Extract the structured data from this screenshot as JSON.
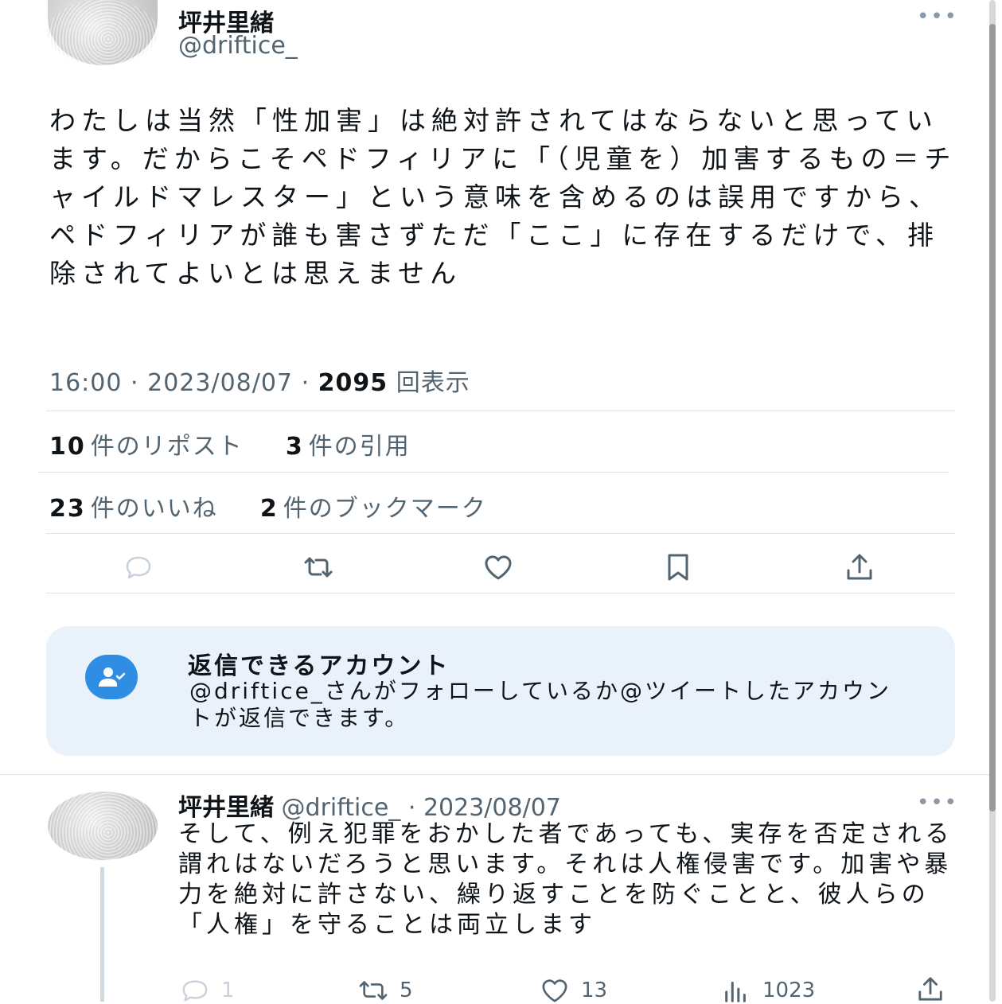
{
  "tweet": {
    "author_name": "坪井里緒",
    "author_handle": "@driftice_",
    "more_label": "•••",
    "text": "わたしは当然「性加害」は絶対許されてはならないと思っています。だからこそペドフィリアに「（児童を）加害するもの＝チャイルドマレスター」という意味を含めるのは誤用ですから、ペドフィリアが誰も害さずただ「ここ」に存在するだけで、排除されてよいとは思えません",
    "time": "16:00",
    "date": "2023/08/07",
    "sep": "·",
    "views_count": "2095",
    "views_label": "回表示"
  },
  "stats": {
    "reposts_count": "10",
    "reposts_label": "件のリポスト",
    "quotes_count": "3",
    "quotes_label": "件の引用",
    "likes_count": "23",
    "likes_label": "件のいいね",
    "bookmarks_count": "2",
    "bookmarks_label": "件のブックマーク"
  },
  "reply_restriction": {
    "title": "返信できるアカウント",
    "description": "@driftice_さんがフォローしているか@ツイートしたアカウントが返信できます。"
  },
  "reply": {
    "author_name": "坪井里緒",
    "author_handle": "@driftice_",
    "date": "· 2023/08/07",
    "more_label": "•••",
    "text": "そして、例え犯罪をおかした者であっても、実存を否定される謂れはないだろうと思います。それは人権侵害です。加害や暴力を絶対に許さない、繰り返すことを防ぐことと、彼人らの「人権」を守ることは両立します",
    "replies": "1",
    "retweets": "5",
    "likes": "13",
    "views": "1023"
  },
  "colors": {
    "accent": "#1d9bf0",
    "badge": "#2f8de4",
    "reply_box_bg": "#e9f2fa",
    "muted": "#536471"
  }
}
